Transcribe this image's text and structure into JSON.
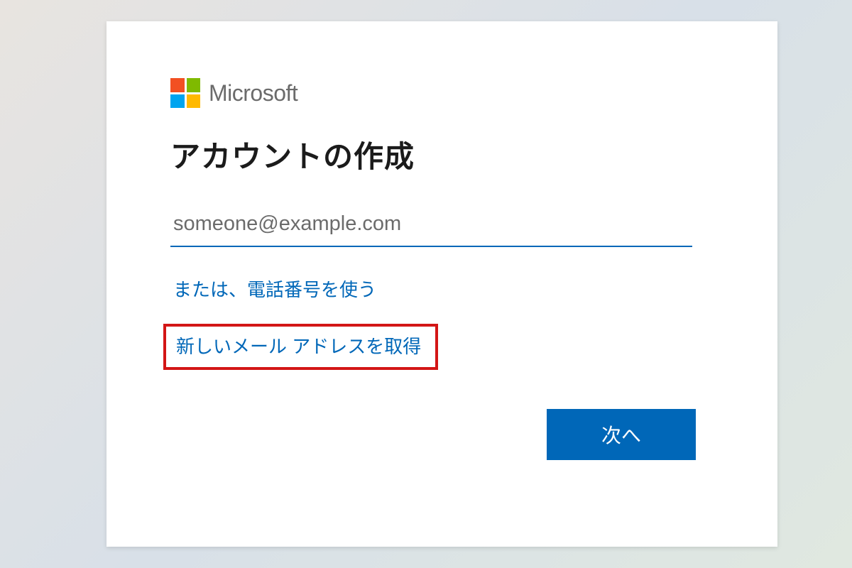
{
  "brand": {
    "name": "Microsoft"
  },
  "heading": "アカウントの作成",
  "email": {
    "placeholder": "someone@example.com",
    "value": ""
  },
  "links": {
    "use_phone": "または、電話番号を使う",
    "get_new_email": "新しいメール アドレスを取得"
  },
  "buttons": {
    "next": "次へ"
  },
  "colors": {
    "accent": "#0067b8",
    "highlight_border": "#d31616"
  }
}
